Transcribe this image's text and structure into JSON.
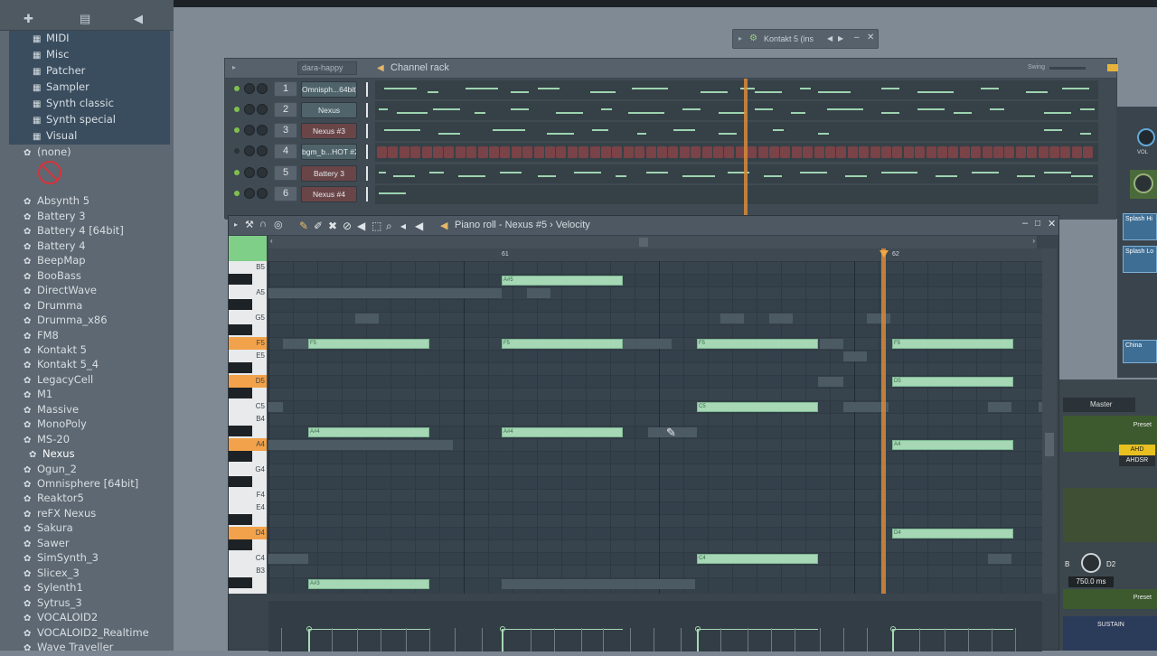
{
  "browser": {
    "top_icons": [
      "add-icon",
      "file-icon",
      "speaker-icon"
    ],
    "folders": [
      "MIDI",
      "Misc",
      "Patcher",
      "Sampler",
      "Synth classic",
      "Synth special",
      "Visual"
    ],
    "items": [
      "(none)",
      "Absynth 5",
      "Battery 3",
      "Battery 4 [64bit]",
      "Battery 4",
      "BeepMap",
      "BooBass",
      "DirectWave",
      "Drumma",
      "Drumma_x86",
      "FM8",
      "Kontakt 5",
      "Kontakt 5_4",
      "LegacyCell",
      "M1",
      "Massive",
      "MonoPoly",
      "MS-20",
      "Nexus",
      "Ogun_2",
      "Omnisphere [64bit]",
      "Reaktor5",
      "reFX Nexus",
      "Sakura",
      "Sawer",
      "SimSynth_3",
      "Slicex_3",
      "Sylenth1",
      "Sytrus_3",
      "VOCALOID2",
      "VOCALOID2_Realtime",
      "Wave Traveller"
    ],
    "selected_item": "Nexus"
  },
  "kontakt_window": {
    "title": "Kontakt 5 (ins"
  },
  "channel_rack": {
    "pattern": "dara-happy",
    "title": "Channel rack",
    "swing_label": "Swing",
    "channels": [
      {
        "num": "1",
        "name": "Omnisph...64bit]"
      },
      {
        "num": "2",
        "name": "Nexus"
      },
      {
        "num": "3",
        "name": "Nexus #3"
      },
      {
        "num": "4",
        "name": "bgm_b...HOT #2"
      },
      {
        "num": "5",
        "name": "Battery 3"
      },
      {
        "num": "6",
        "name": "Nexus #4"
      }
    ]
  },
  "piano_roll": {
    "title": "Piano roll - Nexus #5 › Velocity",
    "bar_61": "61",
    "bar_62": "62",
    "key_labels": [
      "B5",
      "A5",
      "G5",
      "F5",
      "E5",
      "D5",
      "C5",
      "B4",
      "A4",
      "G4",
      "F4",
      "E4",
      "D4",
      "C4",
      "B3"
    ],
    "notes": [
      {
        "label": "A#5"
      },
      {
        "label": "F5"
      },
      {
        "label": "F5"
      },
      {
        "label": "F5"
      },
      {
        "label": "F5"
      },
      {
        "label": "D5"
      },
      {
        "label": "C5"
      },
      {
        "label": "A#4"
      },
      {
        "label": "A#4"
      },
      {
        "label": "A4"
      },
      {
        "label": "D4"
      },
      {
        "label": "C4"
      },
      {
        "label": "A#3"
      }
    ]
  },
  "right_panel": {
    "splash_hi": "Splash Hi",
    "splash_lo": "Splash Lo",
    "china": "China",
    "master": "Master",
    "preset": "Preset",
    "ahd": "AHD",
    "ahdsr": "AHDSR",
    "b_label": "B",
    "d2_label": "D2",
    "time_value": "750.0 ms",
    "sustain": "SUSTAIN",
    "vol": "VOL"
  }
}
